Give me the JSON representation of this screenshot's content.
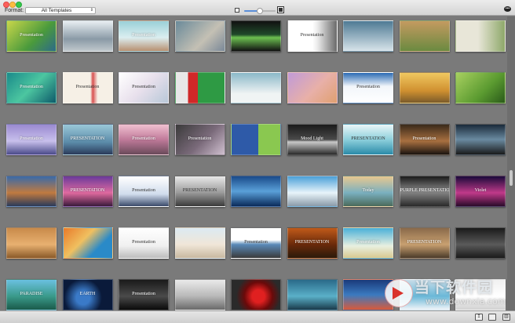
{
  "toolbar": {
    "format_label": "Format:",
    "format_value": "All Templates",
    "zoom_level": 0.5,
    "zoom_small_icon": "small-thumbnail-icon",
    "zoom_large_icon": "large-thumbnail-icon",
    "chat_icon": "speech-bubble-icon"
  },
  "thumbnails": [
    {
      "bg": "linear-gradient(135deg,#c8d64a,#4a9a3c 60%,#2d6a8a)",
      "title": "Presentation",
      "dark": false
    },
    {
      "bg": "linear-gradient(180deg,#e8eef2,#8a9aa6 60%,#c0c8cc)",
      "title": "",
      "dark": false
    },
    {
      "bg": "linear-gradient(180deg,#9ad0d8,#dbeef0 55%,#b89070)",
      "title": "Presentation",
      "dark": false
    },
    {
      "bg": "linear-gradient(135deg,#6a8a9a,#c4c0b4 60%,#7a8898)",
      "title": "",
      "dark": false
    },
    {
      "bg": "linear-gradient(180deg,#111,#1f4a2a 45%,#6cc050 55%,#111)",
      "title": "",
      "dark": false
    },
    {
      "bg": "linear-gradient(90deg,#ffffff 50%,#ececec 60%,#6a6a6a)",
      "title": "Presentation",
      "dark": true
    },
    {
      "bg": "linear-gradient(180deg,#4e7a94,#d8e4ea)",
      "title": "",
      "dark": false
    },
    {
      "bg": "linear-gradient(180deg,#c49a60,#6a8a40)",
      "title": "",
      "dark": false
    },
    {
      "bg": "linear-gradient(90deg,#e8e6d8 45%,#8ea86a)",
      "title": "",
      "dark": false
    },
    {
      "bg": "radial-gradient(circle at 50% 55%,#e04a4a 10%,#2aa6a6 25%,#1a2a4a 60%)",
      "title": "Presentation",
      "dark": false
    },
    {
      "bg": "linear-gradient(135deg,#1a8a8a,#4cc6a0 50%,#0d5a6a)",
      "title": "Presentation",
      "dark": false
    },
    {
      "bg": "linear-gradient(90deg,#f6f0e6 55%,#d85050 60%,#f6f0e6 70%)",
      "title": "Presentation",
      "dark": true
    },
    {
      "bg": "linear-gradient(135deg,#ffffff,#e8e0ec 50%,#b8c8d8)",
      "title": "Presentation",
      "dark": true
    },
    {
      "bg": "linear-gradient(90deg,#e8e8e8 25%,#d02828 25%,#d02828 45%,#2e9a44 45%)",
      "title": "",
      "dark": false
    },
    {
      "bg": "linear-gradient(180deg,#8ab8c8,#f0f4f4 70%)",
      "title": "",
      "dark": false
    },
    {
      "bg": "linear-gradient(135deg,#c09ad8,#e8b0a8 55%,#e0a070)",
      "title": "",
      "dark": false
    },
    {
      "bg": "linear-gradient(180deg,#2a6ab4,#f2f6fa 45%,#ffffff)",
      "title": "Presentation",
      "dark": true
    },
    {
      "bg": "linear-gradient(180deg,#f0c860,#d09030 60%,#7a5a2a)",
      "title": "",
      "dark": false
    },
    {
      "bg": "linear-gradient(135deg,#a8d060,#5a9a30 60%,#2a5a1a)",
      "title": "",
      "dark": false
    },
    {
      "bg": "linear-gradient(180deg,#f2a090,#e85070 55%,#f8c8b8)",
      "title": "",
      "dark": false
    },
    {
      "bg": "linear-gradient(180deg,#9a8ad0,#c8c0ec 55%,#4a4a8a)",
      "title": "Presentation",
      "dark": false
    },
    {
      "bg": "linear-gradient(180deg,#9ac8d8,#5a8aa8 60%,#2a3a5a)",
      "title": "PRESENTATION",
      "dark": false
    },
    {
      "bg": "linear-gradient(180deg,#f0c0d0,#c07a9a 50%,#6a4a5a)",
      "title": "Presentation",
      "dark": false
    },
    {
      "bg": "linear-gradient(135deg,#3a3a3a,#7a6a7a 55%,#d0c0d0)",
      "title": "Presentation",
      "dark": false
    },
    {
      "bg": "linear-gradient(90deg,#2e5aa8 55%,#8ac850 55%)",
      "title": "",
      "dark": false
    },
    {
      "bg": "linear-gradient(180deg,#1a1a1a,#4a4a4a 50%,#c8c8c8 58%,#2a2a2a)",
      "title": "Mood Light",
      "dark": false
    },
    {
      "bg": "linear-gradient(180deg,#eaf6f8,#8ed0dc 50%,#2a8aa8)",
      "title": "PRESENTATION",
      "dark": true
    },
    {
      "bg": "linear-gradient(180deg,#3a2a1a,#a87040 55%,#1a1410)",
      "title": "Presentation",
      "dark": false
    },
    {
      "bg": "linear-gradient(180deg,#1a2a3a,#6a8aa0 50%,#1a1a1a)",
      "title": "",
      "dark": false
    },
    {
      "bg": "linear-gradient(180deg,#2a9ac8,#5ac0e0 60%,#1a6a8a)",
      "title": "Presentation",
      "dark": false
    },
    {
      "bg": "linear-gradient(180deg,#3a6aa8,#c07a40 55%,#2a3a5a)",
      "title": "",
      "dark": false
    },
    {
      "bg": "linear-gradient(180deg,#6a3a9a,#e06aa0 55%,#3a1a3a)",
      "title": "PRESENTATION",
      "dark": false
    },
    {
      "bg": "linear-gradient(180deg,#ffffff,#d0dcec 60%,#3a4a6a)",
      "title": "Presentation",
      "dark": true
    },
    {
      "bg": "linear-gradient(180deg,#e8e8e8,#9a9a9a 55%,#3a3a3a)",
      "title": "PRESENTATION",
      "dark": true
    },
    {
      "bg": "linear-gradient(180deg,#1a4a8a,#5aa0d8 50%,#0a2a5a)",
      "title": "",
      "dark": false
    },
    {
      "bg": "linear-gradient(180deg,#4aa0d8,#e8f4fa 55%,#8a9aa8)",
      "title": "",
      "dark": false
    },
    {
      "bg": "linear-gradient(180deg,#e8c890,#7ab0c0 55%,#4a6a5a)",
      "title": "Today",
      "dark": false
    },
    {
      "bg": "linear-gradient(180deg,#1a1a1a,#8a8a8a 50%,#2a2a2a)",
      "title": "PURPLE PRESENTATION",
      "dark": false
    },
    {
      "bg": "linear-gradient(180deg,#1a0a3a,#c03a8a 55%,#2a0a2a)",
      "title": "Violet",
      "dark": false
    },
    {
      "bg": "linear-gradient(180deg,#2a1a0a,#c85a2a 50%,#1a0a0a)",
      "title": "",
      "dark": false
    },
    {
      "bg": "linear-gradient(180deg,#c88a4a,#e8b070 55%,#8a5a2a)",
      "title": "",
      "dark": false
    },
    {
      "bg": "linear-gradient(135deg,#e87a2a,#f0c060 40%,#2a8ac8 70%)",
      "title": "",
      "dark": false
    },
    {
      "bg": "linear-gradient(180deg,#ffffff,#f0f0f0 60%,#bcbcbc)",
      "title": "Presentation",
      "dark": true
    },
    {
      "bg": "linear-gradient(180deg,#dceaf2,#f0e6d8 55%,#c8b8a0)",
      "title": "",
      "dark": false
    },
    {
      "bg": "linear-gradient(180deg,#ffffff 40%,#5a8ab8 55%,#3a3a3a)",
      "title": "Presentation",
      "dark": true
    },
    {
      "bg": "linear-gradient(180deg,#c05a1a,#6a2a0a 55%,#2a1a0a)",
      "title": "PRESENTATION",
      "dark": false
    },
    {
      "bg": "linear-gradient(180deg,#4ab0d8,#e8f0e0 60%,#d8c890)",
      "title": "Presentation",
      "dark": false
    },
    {
      "bg": "linear-gradient(180deg,#8a6a4a,#c8a070 55%,#4a3a2a)",
      "title": "PRESENTATION",
      "dark": false
    },
    {
      "bg": "linear-gradient(180deg,#1a1a1a,#5a5a5a 55%,#1a1a1a)",
      "title": "",
      "dark": false
    },
    {
      "bg": "linear-gradient(180deg,#2a7ac8,#c8e0f0 55%,#ffffff)",
      "title": "",
      "dark": false
    },
    {
      "bg": "linear-gradient(180deg,#6ac0e0,#3a9a8a 55%,#1a5a4a)",
      "title": "PARADISE",
      "dark": false
    },
    {
      "bg": "radial-gradient(circle at 40% 60%,#3a7ac8 20%,#0a1a3a 55%)",
      "title": "EARTH",
      "dark": false
    },
    {
      "bg": "linear-gradient(180deg,#1a1a1a,#4a4a4a 55%,#0a0a0a)",
      "title": "Presentation",
      "dark": false
    },
    {
      "bg": "linear-gradient(180deg,#eaeaea,#b8b8b8 55%,#6a6a6a)",
      "title": "",
      "dark": false
    },
    {
      "bg": "radial-gradient(circle at 55% 55%,#e02020 20%,#6a0a0a 45%,#2a2a2a 70%)",
      "title": "",
      "dark": false
    },
    {
      "bg": "linear-gradient(180deg,#2a6a8a,#5ab0c8 55%,#1a3a4a)",
      "title": "",
      "dark": false
    },
    {
      "bg": "linear-gradient(180deg,#1a3a7a,#3a7ac0 50%,#d85a3a)",
      "title": "",
      "dark": false
    },
    {
      "bg": "linear-gradient(180deg,#c8dce8,#6ab8d8 55%,#f0f4f8)",
      "title": "",
      "dark": false
    },
    {
      "bg": "linear-gradient(180deg,#f0f0f0,#ffffff 55%,#d0d0d0)",
      "title": "",
      "dark": false
    },
    {
      "bg": "linear-gradient(180deg,#1a1a3a,#3a3a6a 55%,#0a0a1a)",
      "title": "",
      "dark": false
    }
  ],
  "bottom_icons": [
    "export-icon",
    "folder-icon",
    "trash-icon"
  ],
  "watermark": {
    "text": "当下软件园",
    "url": "www.downxia.com"
  }
}
